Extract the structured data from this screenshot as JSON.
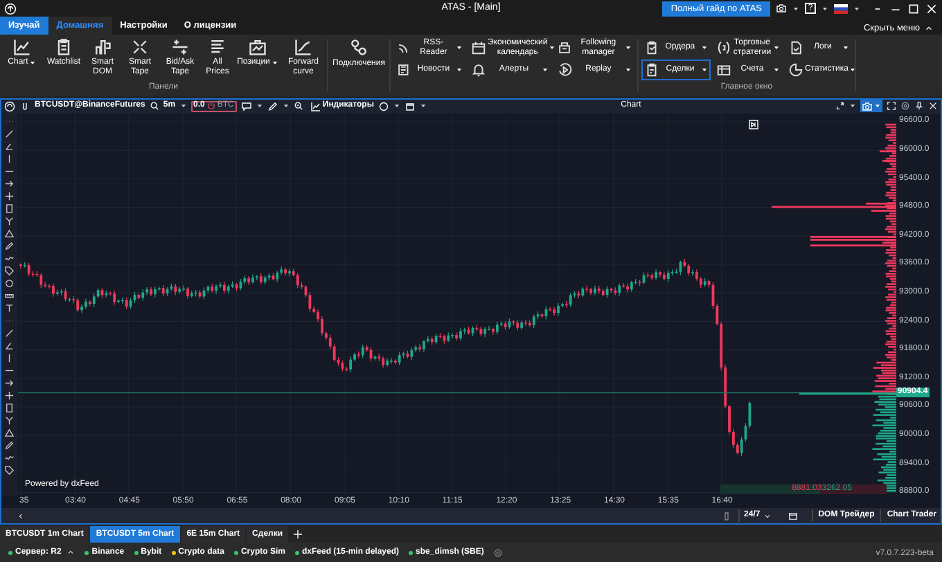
{
  "window": {
    "title": "ATAS - [Main]",
    "guide_button": "Полный гайд по ATAS",
    "help_button": "?"
  },
  "menu_tabs": [
    {
      "label": "Изучай",
      "kind": "promo",
      "selected": false
    },
    {
      "label": "Домашняя",
      "kind": "tab",
      "selected": true
    },
    {
      "label": "Настройки",
      "kind": "tab",
      "selected": false
    },
    {
      "label": "О лицензии",
      "kind": "tab",
      "selected": false
    }
  ],
  "hide_menu": "Скрыть меню",
  "ribbon": {
    "panels": {
      "label": "Панели",
      "items": [
        {
          "label": "Chart",
          "dropdown": true
        },
        {
          "label": "Watchlist",
          "dropdown": false
        },
        {
          "label": "Smart DOM",
          "dropdown": false
        },
        {
          "label": "Smart Tape",
          "dropdown": false
        },
        {
          "label": "Bid/Ask Tape",
          "dropdown": false
        },
        {
          "label": "All Prices",
          "dropdown": false
        },
        {
          "label": "Позиции",
          "dropdown": true
        },
        {
          "label": "Forward curve",
          "dropdown": false
        }
      ]
    },
    "connections": {
      "label": "Подключения"
    },
    "tools": {
      "columns": [
        [
          {
            "label": "RSS-Reader",
            "selected": false
          },
          {
            "label": "Новости",
            "selected": false
          }
        ],
        [
          {
            "label": "Экономический календарь",
            "selected": false
          },
          {
            "label": "Алерты",
            "selected": false
          }
        ],
        [
          {
            "label": "Following manager",
            "selected": false
          },
          {
            "label": "Replay",
            "selected": false
          }
        ]
      ]
    },
    "main_window": {
      "label": "Главное окно",
      "columns": [
        [
          {
            "label": "Ордера",
            "selected": false
          },
          {
            "label": "Сделки",
            "selected": true
          }
        ],
        [
          {
            "label": "Торговые стратегии",
            "selected": false
          },
          {
            "label": "Счета",
            "selected": false
          }
        ],
        [
          {
            "label": "Логи",
            "selected": false
          },
          {
            "label": "Статистика",
            "selected": false
          }
        ]
      ]
    }
  },
  "chart_window": {
    "title": "Chart",
    "symbol": "BTCUSDT@BinanceFutures",
    "timeframe": "5m",
    "quantity": "0.0",
    "currency": "BTC",
    "indicators": "Индикаторы",
    "price_axis": [
      "96600.0",
      "96000.0",
      "95400.0",
      "94800.0",
      "94200.0",
      "93600.0",
      "93000.0",
      "92400.0",
      "91800.0",
      "91200.0",
      "90600.0",
      "90000.0",
      "89400.0",
      "88800.0"
    ],
    "current_price": "90904.4",
    "time_axis": [
      "35",
      "03:40",
      "04:45",
      "05:50",
      "06:55",
      "08:00",
      "09:05",
      "10:10",
      "11:15",
      "12:20",
      "13:25",
      "14:30",
      "15:35",
      "16:40"
    ],
    "credit": "Powered by dxFeed",
    "sell_volume": "8881.03",
    "buy_volume": "3262.05",
    "session": "24/7",
    "buttons": [
      "DOM Трейдер",
      "Chart Trader"
    ]
  },
  "chart_tabs": [
    {
      "label": "BTCUSDT 1m Chart",
      "selected": false
    },
    {
      "label": "BTCUSDT 5m Chart",
      "selected": true
    },
    {
      "label": "6E 15m Chart",
      "selected": false
    },
    {
      "label": "Сделки",
      "selected": false
    }
  ],
  "status_bar": {
    "connections": [
      {
        "label": "Сервер: R2",
        "color": "#3cc46b"
      },
      {
        "label": "Binance",
        "color": "#3cc46b"
      },
      {
        "label": "Bybit",
        "color": "#3cc46b"
      },
      {
        "label": "Crypto data",
        "color": "#e8c21c"
      },
      {
        "label": "Crypto Sim",
        "color": "#3cc46b"
      },
      {
        "label": "dxFeed (15-min delayed)",
        "color": "#3cc46b"
      },
      {
        "label": "sbe_dimsh (SBE)",
        "color": "#3cc46b"
      }
    ],
    "version": "v7.0.7.223-beta"
  }
}
